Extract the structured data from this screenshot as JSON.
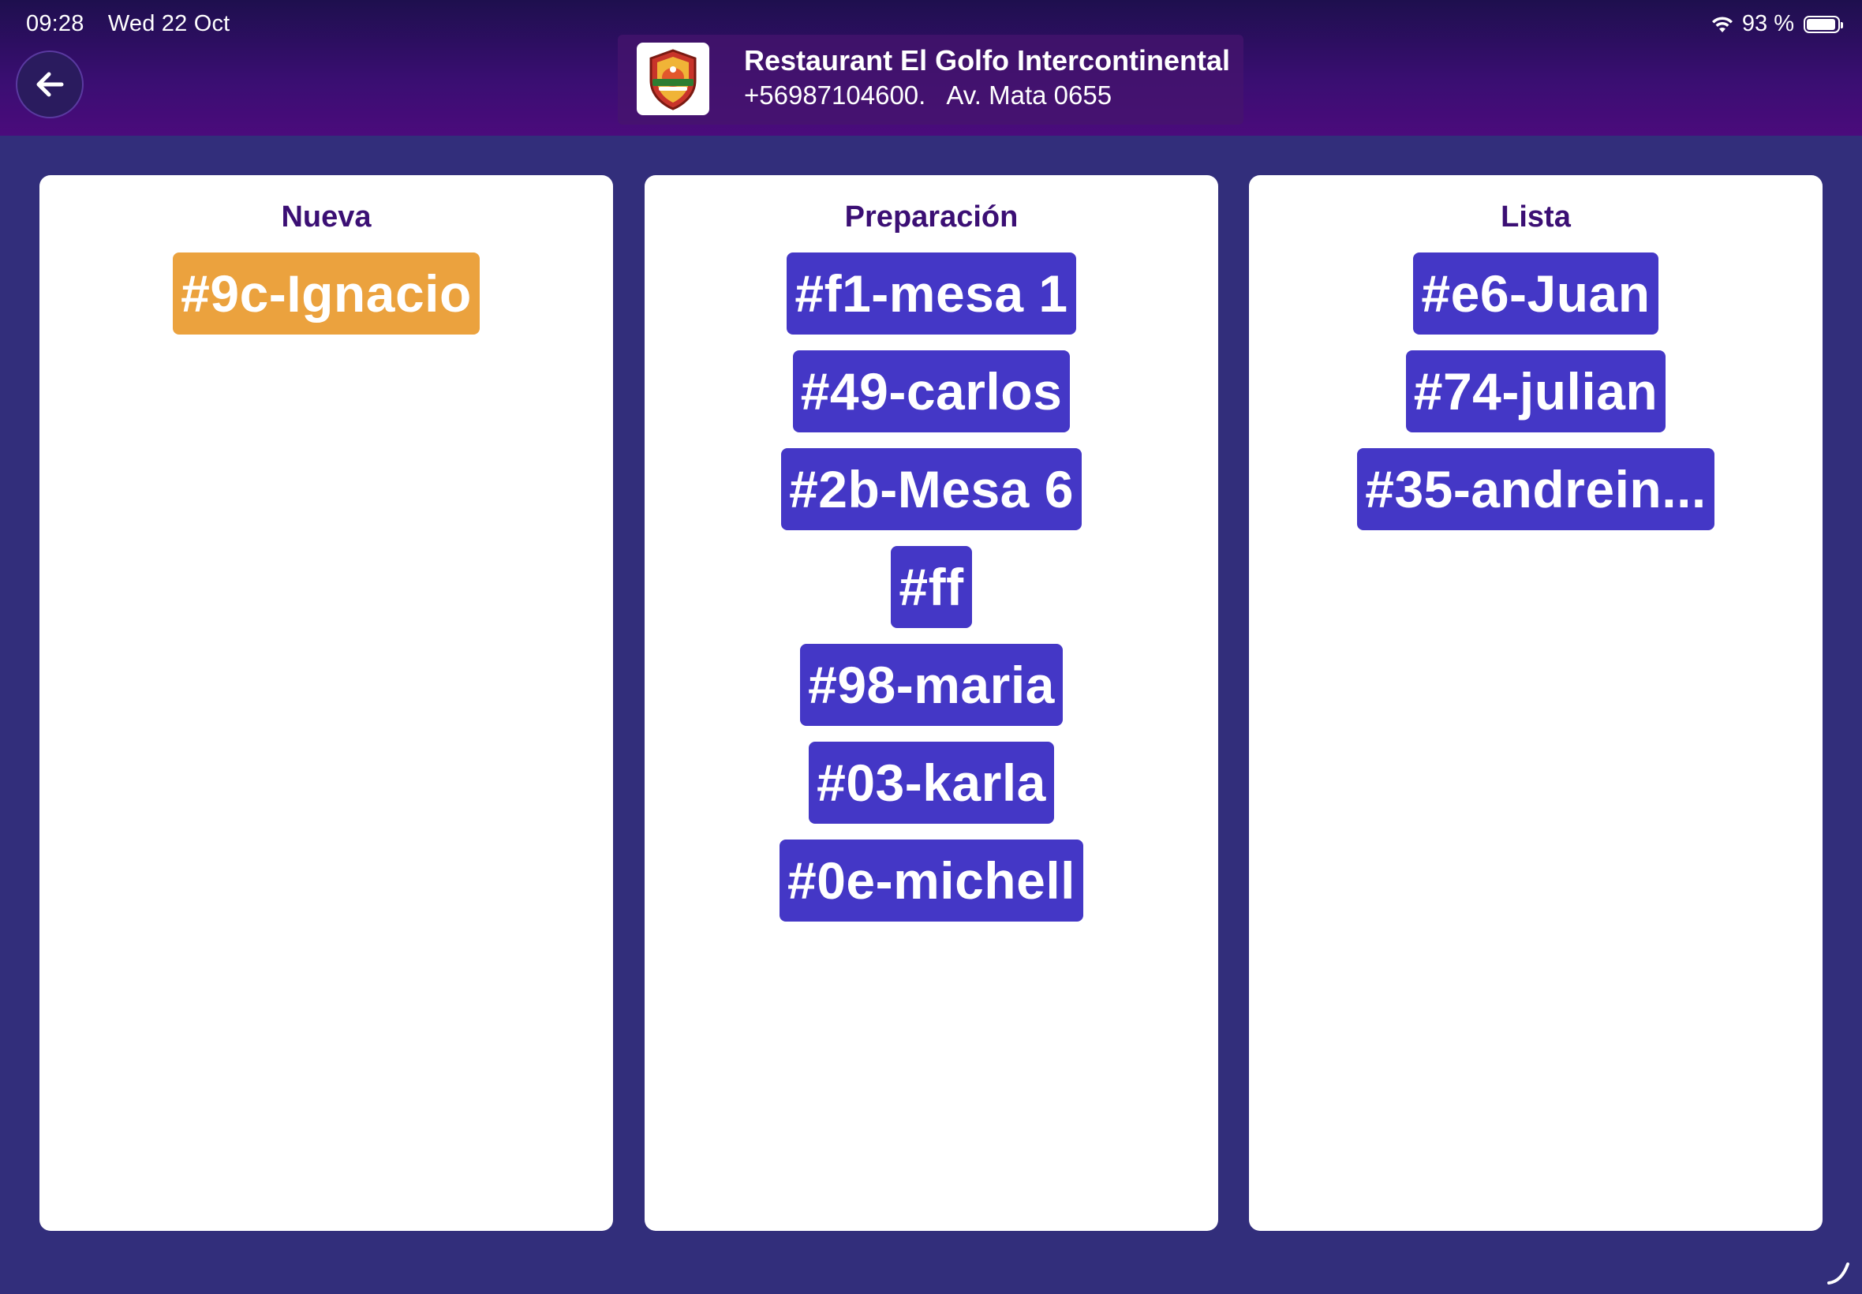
{
  "status_bar": {
    "time": "09:28",
    "date": "Wed 22 Oct",
    "battery": "93 %",
    "battery_level": 0.93
  },
  "header": {
    "back_icon": "arrow-left-icon",
    "restaurant_name": "Restaurant El Golfo Intercontinental",
    "phone": "+56987104600.",
    "address": "Av. Mata 0655",
    "logo_icon": "restaurant-badge-logo"
  },
  "columns": [
    {
      "title": "Nueva",
      "color": "#eba23e",
      "orders": [
        "#9c-Ignacio"
      ]
    },
    {
      "title": "Preparación",
      "color": "#4437c6",
      "orders": [
        "#f1-mesa 1",
        "#49-carlos",
        "#2b-Mesa 6",
        "#ff",
        "#98-maria",
        "#03-karla",
        "#0e-michell"
      ]
    },
    {
      "title": "Lista",
      "color": "#4437c6",
      "orders": [
        "#e6-Juan",
        "#74-julian",
        "#35-andrein..."
      ]
    }
  ],
  "colors": {
    "background": "#322e7b",
    "header_top": "#1e0f4e",
    "header_bottom": "#4b0b7c",
    "title_text": "#3b0f74"
  }
}
